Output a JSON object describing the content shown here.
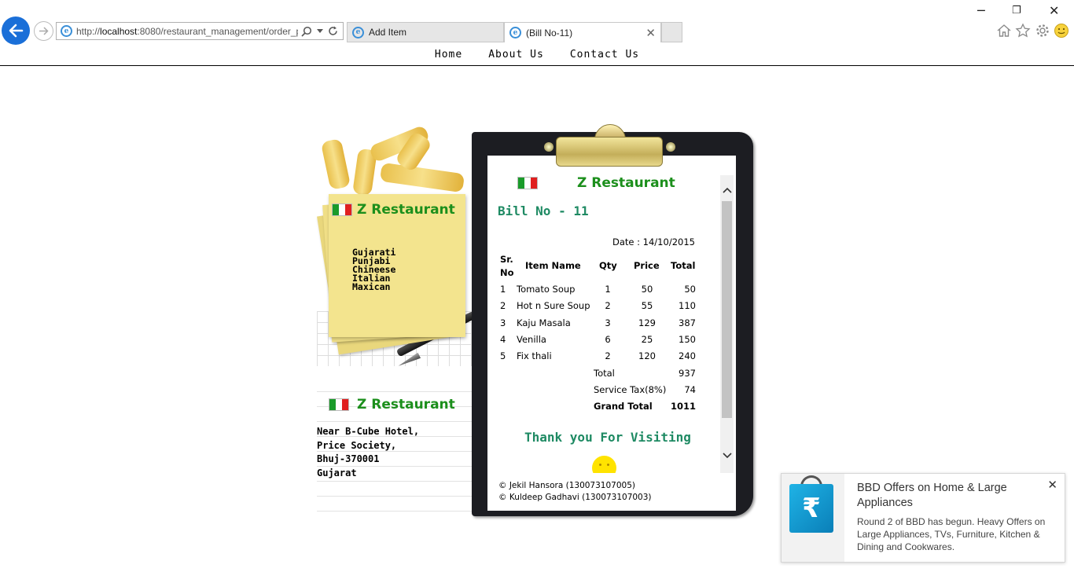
{
  "browser": {
    "url_prefix": "http://",
    "url_host": "localhost",
    "url_rest": ":8080/restaurant_management/order_p",
    "tabs": [
      {
        "label": "Add Item",
        "active": false
      },
      {
        "label": "(Bill No-11)",
        "active": true
      }
    ],
    "window_controls": {
      "minimize": "─",
      "restore": "❐",
      "close": "✕"
    },
    "tab_close": "✕",
    "toolbar_icons": [
      "home-icon",
      "favorites-icon",
      "settings-icon",
      "smiley-icon"
    ]
  },
  "nav": {
    "items": [
      "Home",
      "About Us",
      "Contact Us"
    ]
  },
  "restaurant": {
    "name": "Z Restaurant",
    "cuisines": [
      "Gujarati",
      "Punjabi",
      "Chineese",
      "Italian",
      "Maxican"
    ],
    "address": [
      "Near B-Cube Hotel,",
      "Price Society,",
      "Bhuj-370001",
      "Gujarat"
    ]
  },
  "bill": {
    "restaurant_name": "Z Restaurant",
    "bill_no": "Bill No - 11",
    "date": "Date : 14/10/2015",
    "headers": {
      "sr1": "Sr.",
      "sr2": "No",
      "item": "Item Name",
      "qty": "Qty",
      "price": "Price",
      "total": "Total"
    },
    "rows": [
      {
        "sr": "1",
        "item": "Tomato Soup",
        "qty": "1",
        "price": "50",
        "total": "50"
      },
      {
        "sr": "2",
        "item": "Hot n Sure Soup",
        "qty": "2",
        "price": "55",
        "total": "110"
      },
      {
        "sr": "3",
        "item": "Kaju Masala",
        "qty": "3",
        "price": "129",
        "total": "387"
      },
      {
        "sr": "4",
        "item": "Venilla",
        "qty": "6",
        "price": "25",
        "total": "150"
      },
      {
        "sr": "5",
        "item": "Fix thali",
        "qty": "2",
        "price": "120",
        "total": "240"
      }
    ],
    "summary": [
      {
        "label": "Total",
        "value": "937",
        "bold": false
      },
      {
        "label": "Service Tax(8%)",
        "value": "74",
        "bold": false
      },
      {
        "label": "Grand Total",
        "value": "1011",
        "bold": true
      }
    ],
    "thanks": "Thank you For Visiting",
    "credits": [
      "© Jekil Hansora (130073107005)",
      "© Kuldeep Gadhavi (130073107003)"
    ]
  },
  "notification": {
    "title": "BBD Offers on Home &  Large Appliances",
    "body": "Round 2 of BBD has begun. Heavy Offers on Large Appliances, TVs, Furniture, Kitchen & Dining and Cookwares.",
    "close": "✕",
    "icon": "rupee-shopping-bag-icon",
    "icon_glyph": "₹"
  },
  "colors": {
    "brand_green": "#1c8f1c",
    "bill_teal": "#1e8a63",
    "back_button_blue": "#1a6fd8",
    "sticky_yellow": "#f3e48e",
    "clipboard": "#1c1d22"
  }
}
